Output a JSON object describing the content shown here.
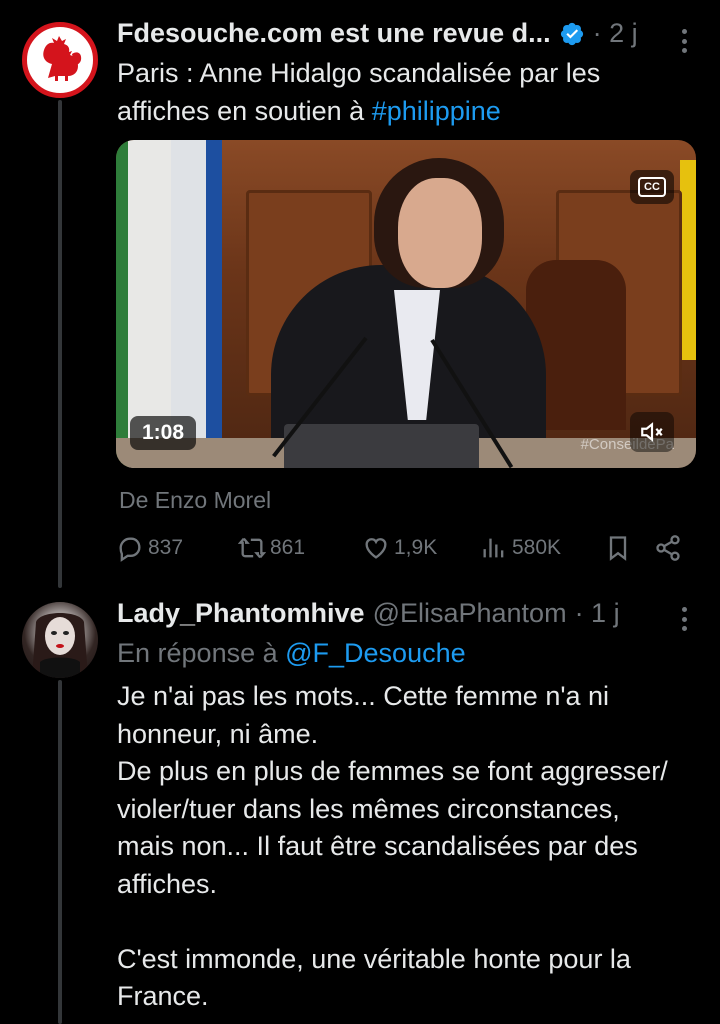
{
  "tweet1": {
    "display_name": "Fdesouche.com est une revue d...",
    "time": "· 2 j",
    "text_line1": "Paris : Anne Hidalgo scandalisée par les",
    "text_line2_prefix": "affiches en soutien à ",
    "hashtag": "#philippine",
    "video": {
      "duration": "1:08",
      "overlay_text": "#ConseildePa",
      "cc_label": "CC"
    },
    "attribution": "De Enzo Morel",
    "actions": {
      "replies": "837",
      "reposts": "861",
      "likes": "1,9K",
      "views": "580K"
    }
  },
  "tweet2": {
    "display_name": "Lady_Phantomhive",
    "handle": "@ElisaPhantom",
    "time": "· 1 j",
    "reply_prefix": "En réponse à ",
    "reply_to": "@F_Desouche",
    "lines": [
      "Je n'ai pas les mots... Cette femme n'a ni",
      "honneur, ni âme.",
      "De plus en plus de femmes se font aggresser/",
      "violer/tuer dans les mêmes circonstances,",
      "mais non... Il faut être scandalisées par des",
      "affiches.",
      "",
      "C'est immonde, une véritable honte pour la",
      "France."
    ]
  },
  "colors": {
    "background": "#000000",
    "text": "#e7e9ea",
    "muted": "#71767b",
    "link": "#1d9bf0",
    "verified": "#1d9bf0",
    "avatar_ring": "#d4141c"
  },
  "icons": [
    "verified-icon",
    "more-icon",
    "reply-icon",
    "repost-icon",
    "like-icon",
    "views-icon",
    "bookmark-icon",
    "share-icon",
    "cc-icon",
    "mute-icon",
    "rooster-logo"
  ]
}
